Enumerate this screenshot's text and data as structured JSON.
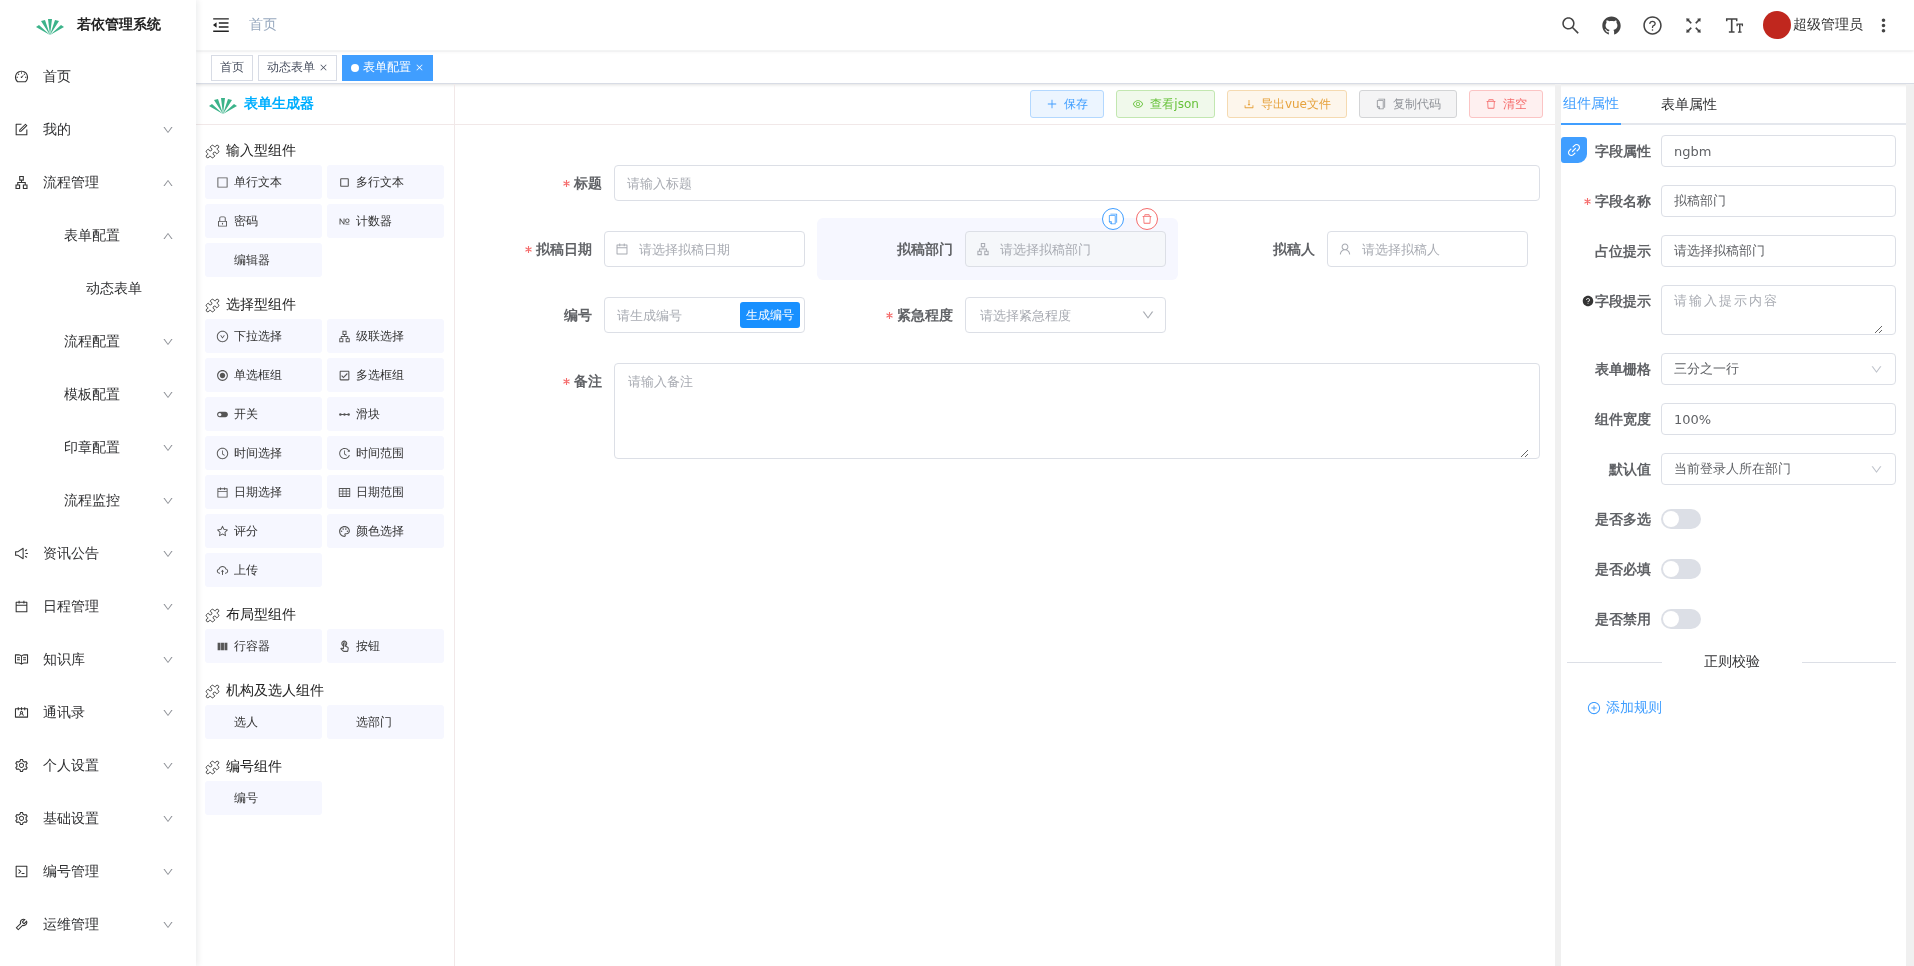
{
  "app": {
    "name": "若依管理系统"
  },
  "sidebar": {
    "items": [
      {
        "label": "首页"
      },
      {
        "label": "我的",
        "expanded": false
      },
      {
        "label": "流程管理",
        "expanded": true,
        "children": [
          {
            "label": "表单配置",
            "expanded": true,
            "children": [
              {
                "label": "动态表单"
              }
            ]
          },
          {
            "label": "流程配置",
            "expanded": false
          },
          {
            "label": "模板配置",
            "expanded": false
          },
          {
            "label": "印章配置",
            "expanded": false
          },
          {
            "label": "流程监控",
            "expanded": false
          }
        ]
      },
      {
        "label": "资讯公告",
        "expanded": false
      },
      {
        "label": "日程管理",
        "expanded": false
      },
      {
        "label": "知识库",
        "expanded": false
      },
      {
        "label": "通讯录",
        "expanded": false
      },
      {
        "label": "个人设置",
        "expanded": false
      },
      {
        "label": "基础设置",
        "expanded": false
      },
      {
        "label": "编号管理",
        "expanded": false
      },
      {
        "label": "运维管理",
        "expanded": false
      }
    ]
  },
  "header": {
    "breadcrumb": "首页",
    "user": "超级管理员"
  },
  "tags": [
    {
      "label": "首页",
      "selected": false,
      "closable": false
    },
    {
      "label": "动态表单",
      "selected": false,
      "closable": true
    },
    {
      "label": "表单配置",
      "selected": true,
      "closable": true
    }
  ],
  "builder": {
    "title": "表单生成器",
    "actions": [
      {
        "label": "保存",
        "kind": "primary"
      },
      {
        "label": "查看json",
        "kind": "success"
      },
      {
        "label": "导出vue文件",
        "kind": "warning"
      },
      {
        "label": "复制代码",
        "kind": "info"
      },
      {
        "label": "清空",
        "kind": "danger"
      }
    ]
  },
  "palette": [
    {
      "title": "输入型组件",
      "items": [
        "单行文本",
        "多行文本",
        "密码",
        "计数器",
        "编辑器"
      ]
    },
    {
      "title": "选择型组件",
      "items": [
        "下拉选择",
        "级联选择",
        "单选框组",
        "多选框组",
        "开关",
        "滑块",
        "时间选择",
        "时间范围",
        "日期选择",
        "日期范围",
        "评分",
        "颜色选择",
        "上传"
      ]
    },
    {
      "title": "布局型组件",
      "items": [
        "行容器",
        "按钮"
      ]
    },
    {
      "title": "机构及选人组件",
      "items": [
        "选人",
        "选部门"
      ]
    },
    {
      "title": "编号组件",
      "items": [
        "编号"
      ]
    }
  ],
  "form": {
    "rows": [
      [
        {
          "label": "标题",
          "required": true,
          "kind": "input",
          "placeholder": "请输入标题",
          "selected": false
        }
      ],
      [
        {
          "label": "拟稿日期",
          "required": true,
          "kind": "date",
          "placeholder": "请选择拟稿日期",
          "selected": false
        },
        {
          "label": "拟稿部门",
          "required": false,
          "kind": "dept",
          "placeholder": "请选择拟稿部门",
          "selected": true
        },
        {
          "label": "拟稿人",
          "required": false,
          "kind": "user",
          "placeholder": "请选择拟稿人",
          "selected": false
        }
      ],
      [
        {
          "label": "编号",
          "required": false,
          "kind": "serial",
          "placeholder": "请生成编号",
          "button": "生成编号",
          "selected": false
        },
        {
          "label": "紧急程度",
          "required": true,
          "kind": "select",
          "placeholder": "请选择紧急程度",
          "selected": false
        }
      ],
      [
        {
          "label": "备注",
          "required": true,
          "kind": "textarea",
          "placeholder": "请输入备注",
          "selected": false
        }
      ]
    ]
  },
  "panel": {
    "tabs": [
      {
        "label": "组件属性",
        "selected": true
      },
      {
        "label": "表单属性",
        "selected": false
      }
    ],
    "props": [
      {
        "label": "字段属性",
        "required": false,
        "help": false,
        "kind": "input",
        "value": "ngbm"
      },
      {
        "label": "字段名称",
        "required": true,
        "help": false,
        "kind": "input",
        "value": "拟稿部门"
      },
      {
        "label": "占位提示",
        "required": false,
        "help": false,
        "kind": "input",
        "value": "请选择拟稿部门"
      },
      {
        "label": "字段提示",
        "required": false,
        "help": true,
        "kind": "textarea",
        "placeholder": "请输入提示内容"
      },
      {
        "label": "表单栅格",
        "required": false,
        "help": false,
        "kind": "select",
        "value": "三分之一行"
      },
      {
        "label": "组件宽度",
        "required": false,
        "help": false,
        "kind": "input",
        "value": "100%"
      },
      {
        "label": "默认值",
        "required": false,
        "help": false,
        "kind": "select",
        "value": "当前登录人所在部门"
      },
      {
        "label": "是否多选",
        "required": false,
        "help": false,
        "kind": "switch",
        "on": false
      },
      {
        "label": "是否必填",
        "required": false,
        "help": false,
        "kind": "switch",
        "on": false
      },
      {
        "label": "是否禁用",
        "required": false,
        "help": false,
        "kind": "switch",
        "on": false
      }
    ],
    "divider": "正则校验",
    "add_rule": "添加规则"
  }
}
